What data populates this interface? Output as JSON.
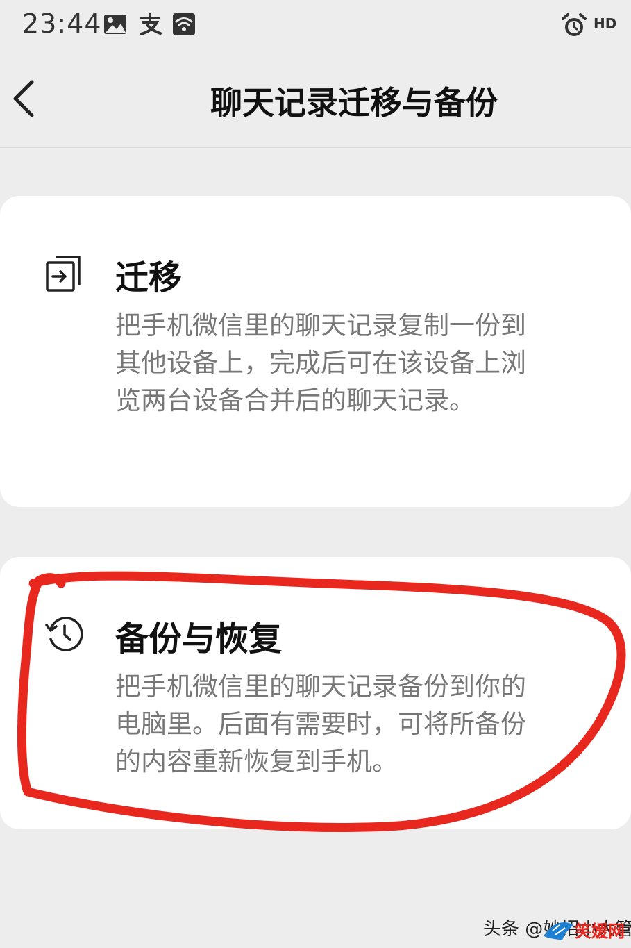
{
  "status_bar": {
    "time": "23:44",
    "icons": [
      "image-icon",
      "alipay-icon",
      "wifi-icon",
      "alarm-icon"
    ],
    "hd_label": "HD"
  },
  "nav": {
    "back_icon": "chevron-left-icon",
    "title": "聊天记录迁移与备份"
  },
  "options": [
    {
      "icon": "migrate-icon",
      "title": "迁移",
      "description": "把手机微信里的聊天记录复制一份到其他设备上，完成后可在该设备上浏览两台设备合并后的聊天记录。"
    },
    {
      "icon": "history-icon",
      "title": "备份与恢复",
      "description": "把手机微信里的聊天记录备份到你的电脑里。后面有需要时，可将所备份的内容重新恢复到手机。"
    }
  ],
  "annotation": {
    "color": "#e8281f"
  },
  "watermark": {
    "text": "头条 @妙招小大管",
    "logo_text": "笑媛网"
  }
}
